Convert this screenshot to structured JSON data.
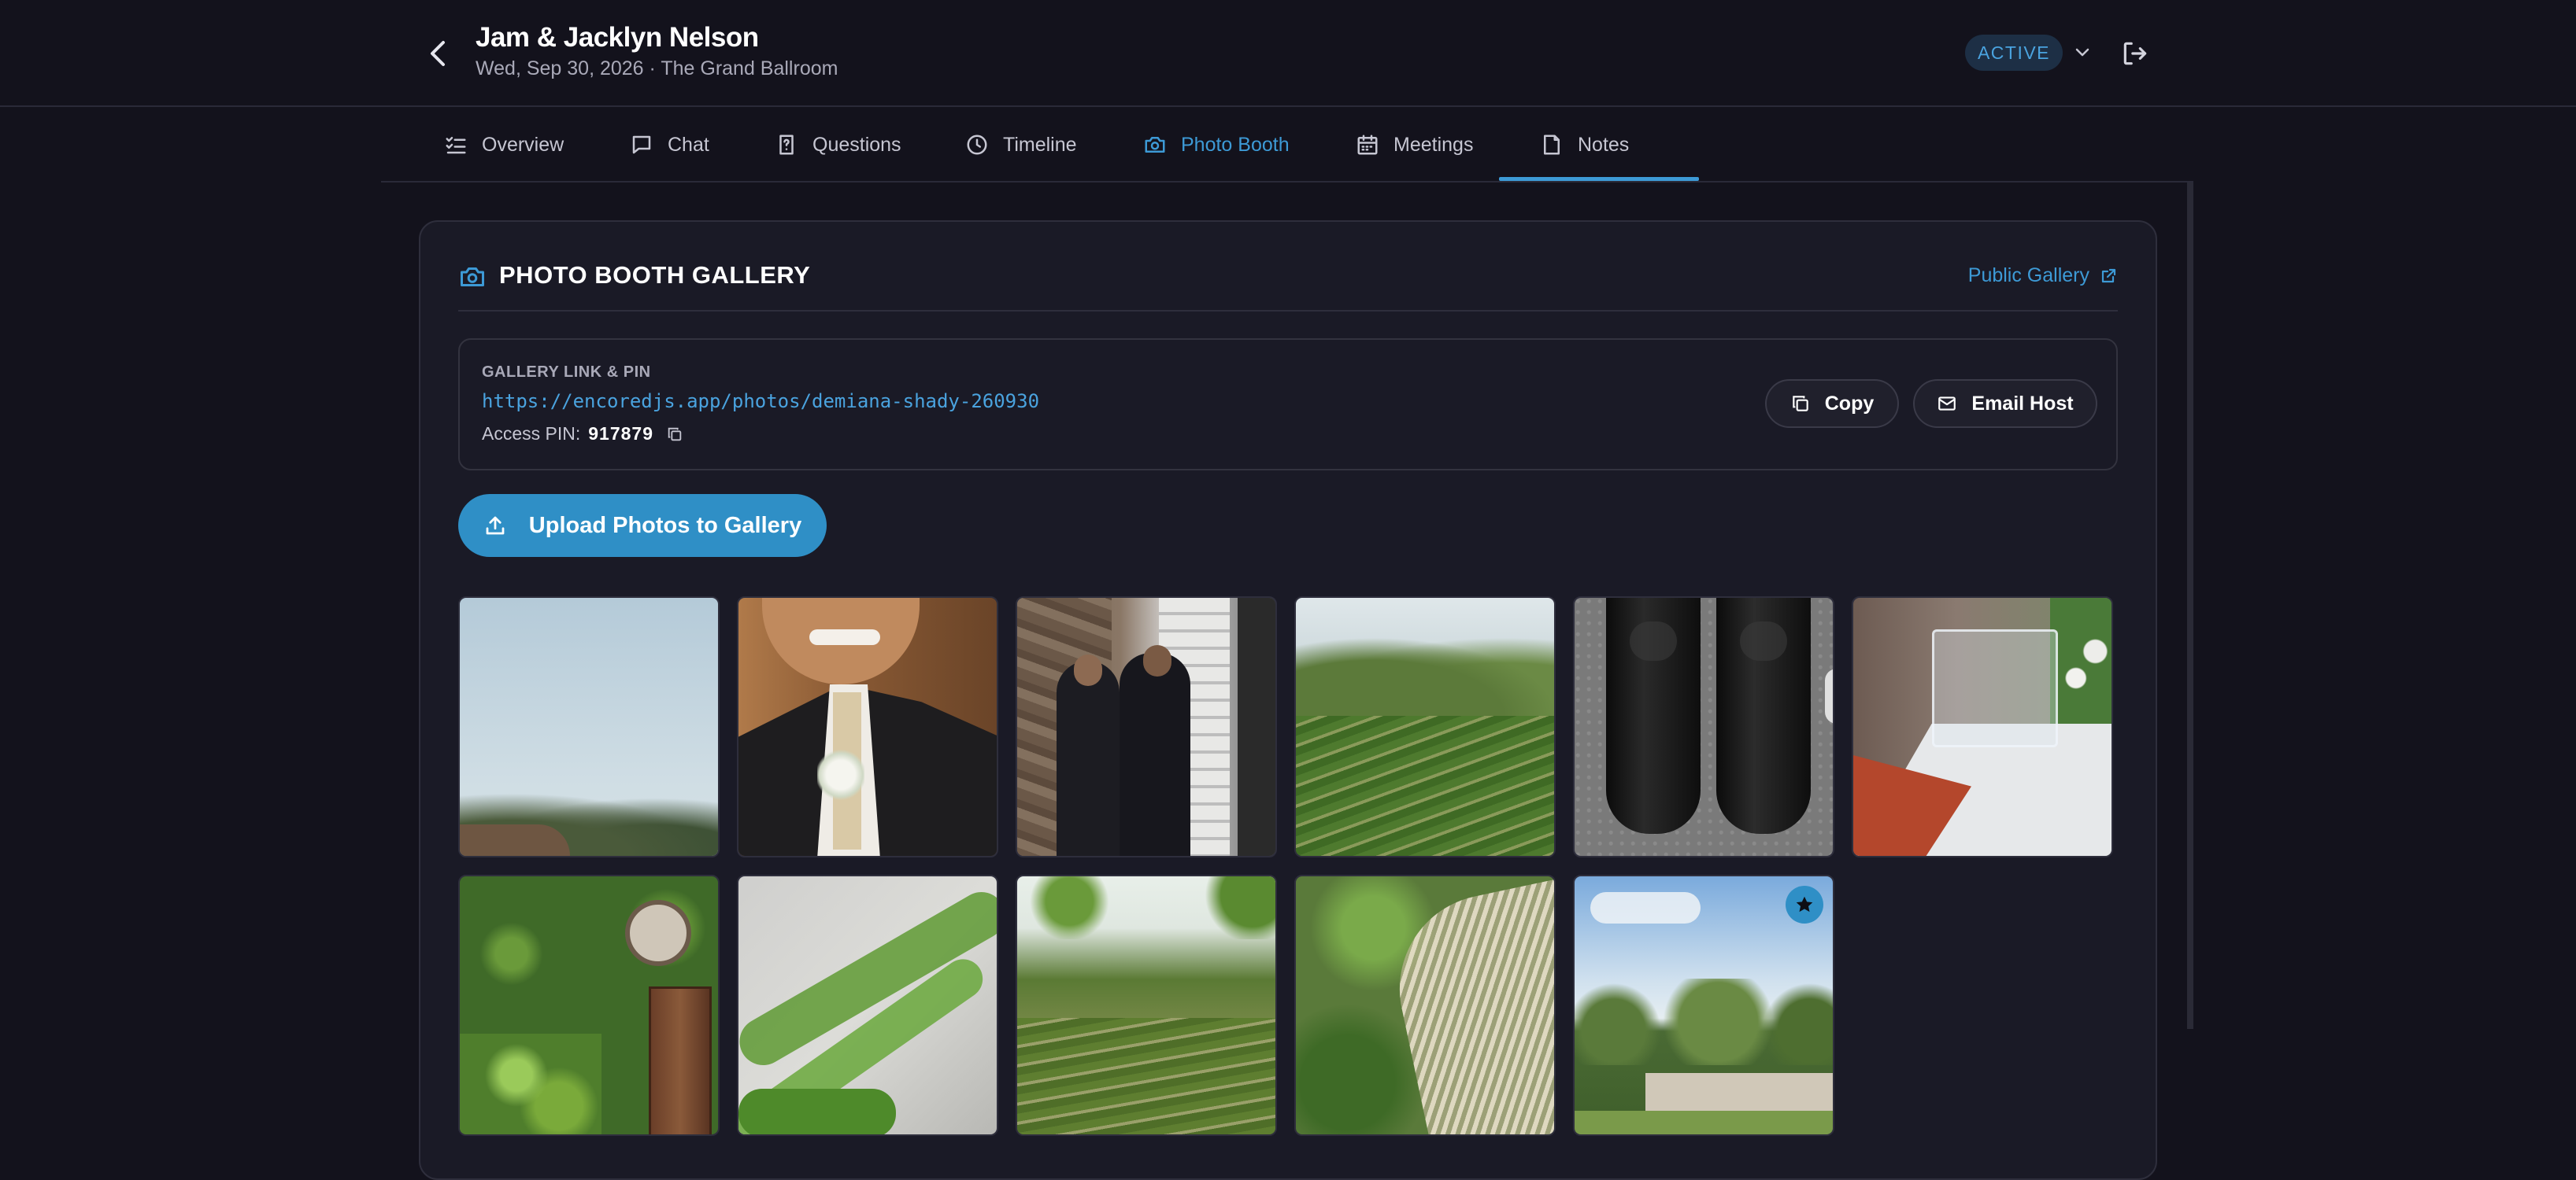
{
  "header": {
    "title": "Jam & Jacklyn Nelson",
    "subtitle": "Wed, Sep 30, 2026 · The Grand Ballroom",
    "status": "ACTIVE"
  },
  "tabs": [
    {
      "label": "Overview",
      "icon": "list-check-icon"
    },
    {
      "label": "Chat",
      "icon": "chat-bubble-icon"
    },
    {
      "label": "Questions",
      "icon": "question-file-icon"
    },
    {
      "label": "Timeline",
      "icon": "clock-icon"
    },
    {
      "label": "Photo Booth",
      "icon": "camera-icon",
      "active": true
    },
    {
      "label": "Meetings",
      "icon": "calendar-icon"
    },
    {
      "label": "Notes",
      "icon": "note-icon"
    }
  ],
  "gallery": {
    "title": "PHOTO BOOTH GALLERY",
    "public_link_label": "Public Gallery",
    "link_section_label": "GALLERY LINK & PIN",
    "url": "https://encoredjs.app/photos/demiana-shady-260930",
    "pin_label": "Access PIN:",
    "pin": "917879",
    "copy_label": "Copy",
    "email_label": "Email Host",
    "upload_label": "Upload Photos to Gallery"
  },
  "photos": [
    {
      "subject": "sky and treetops",
      "favorite": false
    },
    {
      "subject": "groom smiling with boutonniere",
      "favorite": false
    },
    {
      "subject": "groomsmen adjusting tie",
      "favorite": false
    },
    {
      "subject": "vineyard hills",
      "favorite": false
    },
    {
      "subject": "black dress shoes",
      "favorite": false
    },
    {
      "subject": "acrylic card box on table",
      "favorite": false
    },
    {
      "subject": "ivy covered wall and door",
      "favorite": false
    },
    {
      "subject": "ivy on stone wall",
      "favorite": false
    },
    {
      "subject": "vineyard valley",
      "favorite": false
    },
    {
      "subject": "pampas grass close-up",
      "favorite": false
    },
    {
      "subject": "winery entrance sign",
      "favorite": true
    }
  ],
  "colors": {
    "accent": "#3d9ad6",
    "background": "#13121c",
    "card": "#1a1a26"
  }
}
